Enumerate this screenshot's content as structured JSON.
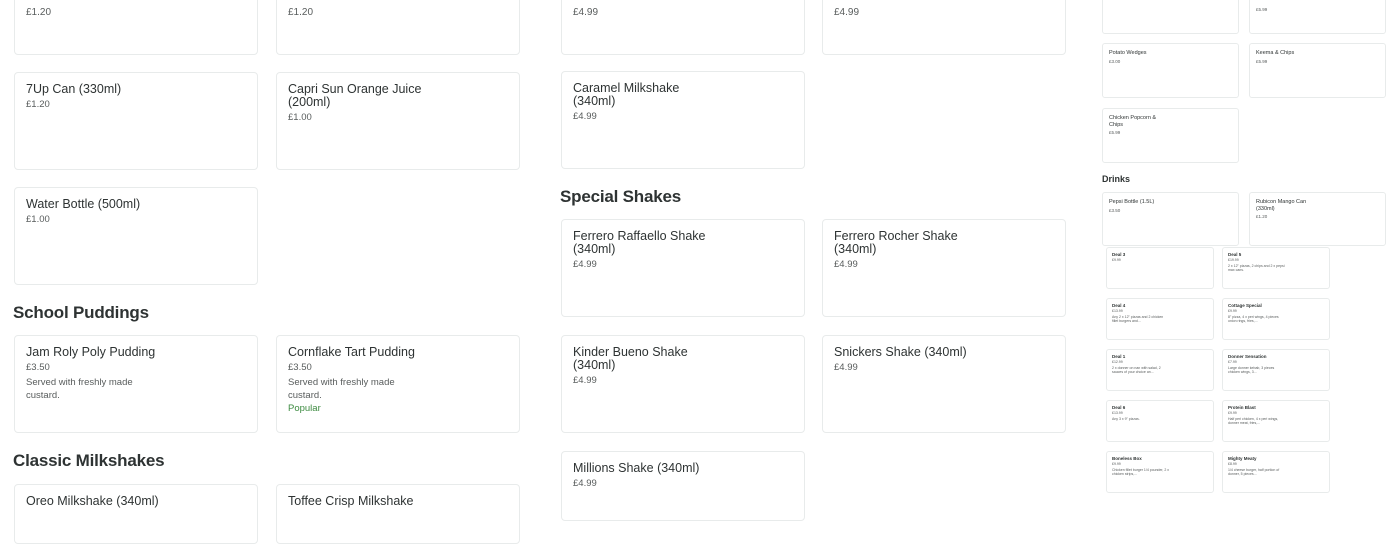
{
  "left_column": {
    "cards": [
      {
        "price": "£1.20"
      },
      {
        "price": "£1.20"
      },
      {
        "title": "7Up Can (330ml)",
        "price": "£1.20"
      },
      {
        "title": "Capri Sun Orange Juice (200ml)",
        "price": "£1.00"
      },
      {
        "title": "Water Bottle (500ml)",
        "price": "£1.00"
      }
    ],
    "school_puddings": {
      "heading": "School Puddings",
      "items": [
        {
          "title": "Jam Roly Poly Pudding",
          "price": "£3.50",
          "desc": "Served with freshly made custard."
        },
        {
          "title": "Cornflake Tart Pudding",
          "price": "£3.50",
          "desc": "Served with freshly made custard.",
          "badge": "Popular"
        }
      ]
    },
    "classic_milkshakes": {
      "heading": "Classic Milkshakes",
      "items": [
        {
          "title": "Oreo Milkshake (340ml)"
        },
        {
          "title": "Toffee Crisp Milkshake"
        }
      ]
    }
  },
  "middle_column": {
    "cards": [
      {
        "price": "£4.99"
      },
      {
        "price": "£4.99"
      },
      {
        "title": "Caramel Milkshake (340ml)",
        "price": "£4.99"
      }
    ],
    "special_shakes": {
      "heading": "Special Shakes",
      "items": [
        {
          "title": "Ferrero Raffaello Shake (340ml)",
          "price": "£4.99"
        },
        {
          "title": "Ferrero Rocher Shake (340ml)",
          "price": "£4.99"
        },
        {
          "title": "Kinder Bueno Shake (340ml)",
          "price": "£4.99"
        },
        {
          "title": "Snickers Shake (340ml)",
          "price": "£4.99"
        },
        {
          "title": "Millions Shake (340ml)",
          "price": "£4.99"
        }
      ]
    }
  },
  "preview_column": {
    "top_cards": [
      {
        "price": "£5.99"
      },
      {
        "title": "Potato Wedges",
        "price": "£3.00"
      },
      {
        "title": "Keema & Chips",
        "price": "£5.99"
      },
      {
        "title": "Chicken Popcorn & Chips",
        "price": "£5.99"
      }
    ],
    "drinks": {
      "heading": "Drinks",
      "items": [
        {
          "title": "Pepsi Bottle (1.5L)",
          "price": "£3.50"
        },
        {
          "title": "Rubicon Mango Can (330ml)",
          "price": "£1.20"
        }
      ]
    },
    "deals": [
      {
        "title": "Deal 3",
        "price": "£9.99",
        "desc": ""
      },
      {
        "title": "Deal 5",
        "price": "£19.99",
        "desc": "2 x 12\" pizzas, 2 chips and 2 x pepsi max cans."
      },
      {
        "title": "Deal 4",
        "price": "£13.99",
        "desc": "Any 2 x 12\" pizzas and 2 chicken fillet burgers and..."
      },
      {
        "title": "Cottage Special",
        "price": "£9.99",
        "desc": "8\" pizza, 4 x peri wings, 4 pieces onion rings, fries,..."
      },
      {
        "title": "Deal 1",
        "price": "£12.99",
        "desc": "2 x donner on nan with salad, 2 sauces of your choice an..."
      },
      {
        "title": "Donner Sensation",
        "price": "£7.99",
        "desc": "Large donner kebab, 3 pieces chicken wings, 3..."
      },
      {
        "title": "Deal 6",
        "price": "£13.99",
        "desc": "Any 3 x 9\" pizzas."
      },
      {
        "title": "Protein Blast",
        "price": "£9.99",
        "desc": "Half peri chicken, 4 x peri wings, donner meat, fries,..."
      },
      {
        "title": "Boneless Box",
        "price": "£9.99",
        "desc": "Chicken fillet burger 1/4 pounder, 2 x chicken strips,..."
      },
      {
        "title": "Mighty Meaty",
        "price": "£8.99",
        "desc": "1/4 cheese burger, half portion of donner, 5 pieces..."
      }
    ]
  }
}
